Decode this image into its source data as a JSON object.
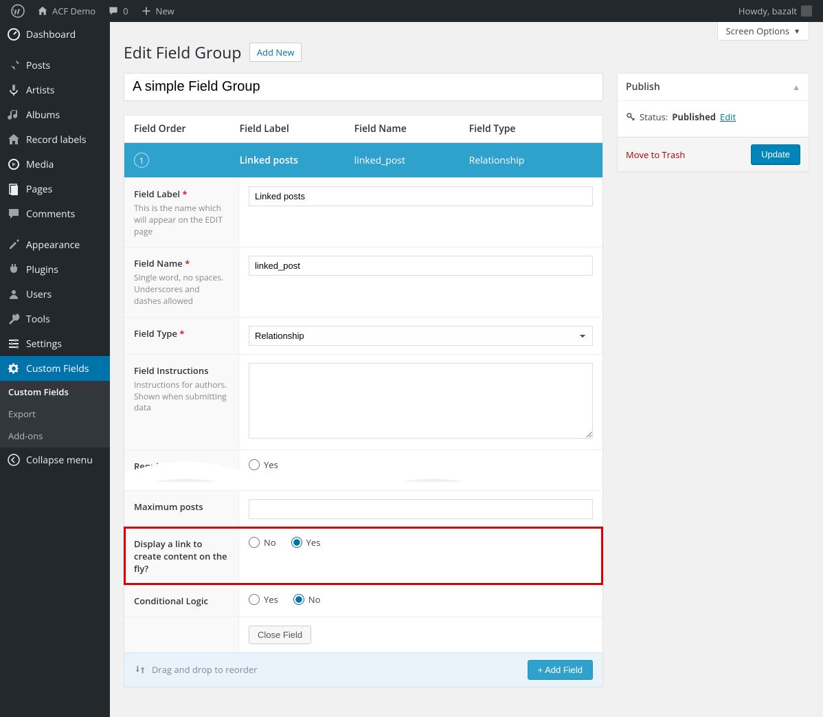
{
  "adminbar": {
    "site_name": "ACF Demo",
    "comments_count": "0",
    "new_label": "New",
    "howdy": "Howdy, bazalt"
  },
  "sidebar": {
    "items": [
      {
        "label": "Dashboard",
        "icon": "dashboard"
      },
      {
        "label": "Posts",
        "icon": "pin"
      },
      {
        "label": "Artists",
        "icon": "mic"
      },
      {
        "label": "Albums",
        "icon": "music"
      },
      {
        "label": "Record labels",
        "icon": "home"
      },
      {
        "label": "Media",
        "icon": "media"
      },
      {
        "label": "Pages",
        "icon": "pages"
      },
      {
        "label": "Comments",
        "icon": "comment"
      },
      {
        "label": "Appearance",
        "icon": "brush"
      },
      {
        "label": "Plugins",
        "icon": "plug"
      },
      {
        "label": "Users",
        "icon": "user"
      },
      {
        "label": "Tools",
        "icon": "wrench"
      },
      {
        "label": "Settings",
        "icon": "sliders"
      },
      {
        "label": "Custom Fields",
        "icon": "gear"
      }
    ],
    "submenu": [
      {
        "label": "Custom Fields",
        "current": true
      },
      {
        "label": "Export"
      },
      {
        "label": "Add-ons"
      }
    ],
    "collapse": "Collapse menu"
  },
  "screen_options": "Screen Options",
  "page": {
    "title": "Edit Field Group",
    "add_new": "Add New",
    "group_title": "A simple Field Group"
  },
  "publish": {
    "header": "Publish",
    "status_label": "Status:",
    "status_value": "Published",
    "edit": "Edit",
    "trash": "Move to Trash",
    "update": "Update"
  },
  "thead": {
    "order": "Field Order",
    "label": "Field Label",
    "name": "Field Name",
    "type": "Field Type"
  },
  "row": {
    "order": "1",
    "label": "Linked posts",
    "name": "linked_post",
    "type": "Relationship"
  },
  "settings": {
    "field_label": {
      "label": "Field Label",
      "desc": "This is the name which will appear on the EDIT page",
      "value": "Linked posts"
    },
    "field_name": {
      "label": "Field Name",
      "desc": "Single word, no spaces. Underscores and dashes allowed",
      "value": "linked_post"
    },
    "field_type": {
      "label": "Field Type",
      "value": "Relationship"
    },
    "instructions": {
      "label": "Field Instructions",
      "desc": "Instructions for authors. Shown when submitting data",
      "value": ""
    },
    "required": {
      "label": "Required?",
      "yes": "Yes"
    },
    "max_posts": {
      "label": "Maximum posts",
      "value": ""
    },
    "display_link": {
      "label": "Display a link to create content on the fly?",
      "no": "No",
      "yes": "Yes"
    },
    "conditional": {
      "label": "Conditional Logic",
      "yes": "Yes",
      "no": "No"
    },
    "close": "Close Field"
  },
  "footer": {
    "reorder": "Drag and drop to reorder",
    "add_field": "+ Add Field"
  }
}
